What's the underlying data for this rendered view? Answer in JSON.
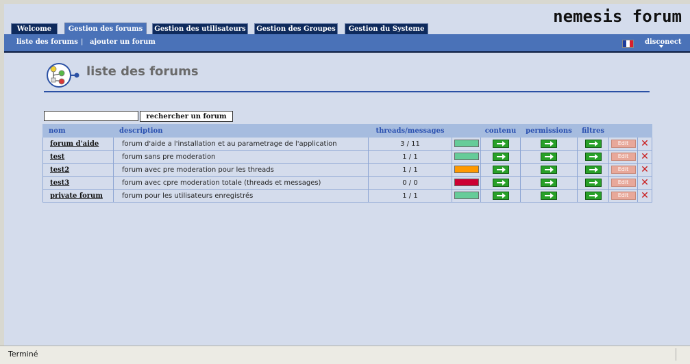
{
  "tabs": [
    {
      "label": "Welcome"
    },
    {
      "label": "Gestion des forums"
    },
    {
      "label": "Gestion des utilisateurs"
    },
    {
      "label": "Gestion des Groupes"
    },
    {
      "label": "Gestion du Systeme"
    }
  ],
  "logo": "nemesis forum",
  "subnav": {
    "list_label": "liste des forums",
    "separator": "|",
    "add_label": "ajouter un forum",
    "disconnect_label": "disconect"
  },
  "flag_colors": [
    "#1e3c9c",
    "#ffffff",
    "#d81e2c"
  ],
  "page_title": "liste des forums",
  "search": {
    "value": "",
    "button_label": "rechercher un forum"
  },
  "table": {
    "headers": {
      "nom": "nom",
      "description": "description",
      "threads": "threads/messages",
      "contenu": "contenu",
      "permissions": "permissions",
      "filtres": "filtres"
    },
    "edit_label": "Edit",
    "delete_glyph": "✕",
    "rows": [
      {
        "name": "forum d'aide",
        "description": "forum d'aide a l'installation et au parametrage de l'application",
        "count": "3 / 11",
        "status_color": "#66cc99"
      },
      {
        "name": "test",
        "description": "forum sans pre moderation",
        "count": "1 / 1",
        "status_color": "#66cc99"
      },
      {
        "name": "test2",
        "description": "forum avec pre moderation pour les threads",
        "count": "1 / 1",
        "status_color": "#ff9900"
      },
      {
        "name": "test3",
        "description": "forum avec cpre moderation totale (threads et messages)",
        "count": "0 / 0",
        "status_color": "#cc0033"
      },
      {
        "name": "private forum",
        "description": "forum pour les utilisateurs enregistrés",
        "count": "1 / 1",
        "status_color": "#66cc99"
      }
    ]
  },
  "statusbar": {
    "text": "Terminé"
  }
}
